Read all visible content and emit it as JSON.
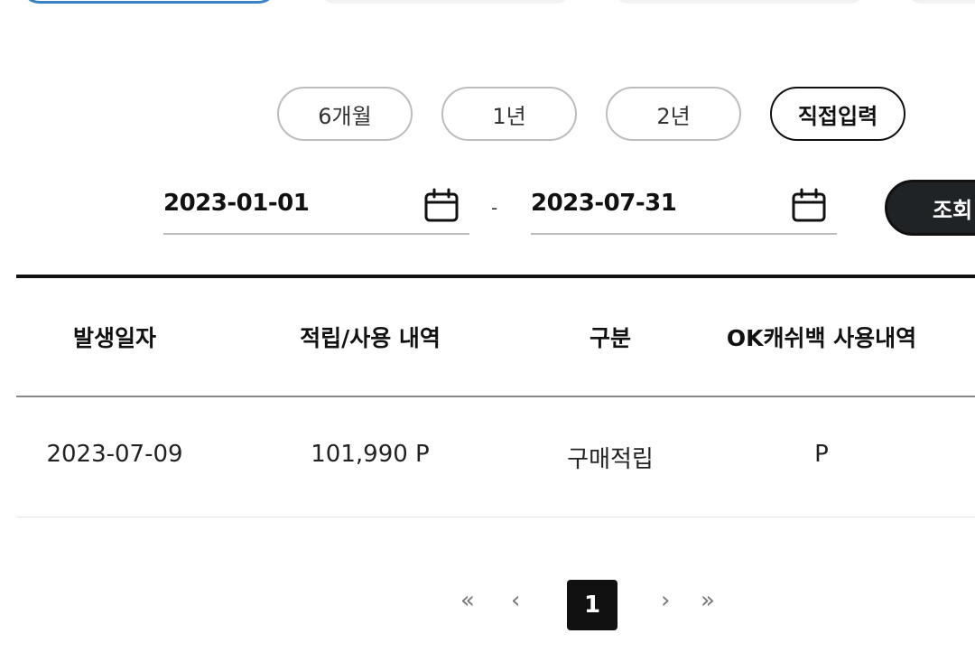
{
  "period_filters": {
    "options": [
      "6개월",
      "1년",
      "2년",
      "직접입력"
    ],
    "selected": "직접입력"
  },
  "date_range": {
    "start": "2023-01-01",
    "separator": "-",
    "end": "2023-07-31"
  },
  "search_button": {
    "label": "조회"
  },
  "table": {
    "headers": [
      "발생일자",
      "적립/사용 내역",
      "구분",
      "OK캐쉬백 사용내역"
    ],
    "rows": [
      [
        "2023-07-09",
        "101,990 P",
        "구매적립",
        "P"
      ]
    ]
  },
  "pagination": {
    "first": "«",
    "prev": "‹",
    "current": "1",
    "next": "›",
    "last": "»"
  },
  "colors": {
    "accent": "#3b82c4",
    "primary_dark": "#1f2325"
  },
  "icons": {
    "date_picker": "calendar-icon"
  }
}
